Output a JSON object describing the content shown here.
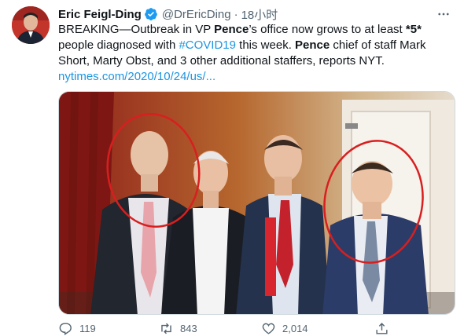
{
  "tweet": {
    "author_name": "Eric Feigl-Ding",
    "handle": "@DrEricDing",
    "separator": "·",
    "time": "18小时",
    "text": {
      "p1": "BREAKING—Outbreak in VP ",
      "b1": "Pence",
      "p2": "’s office now grows to at least ",
      "b2": "*5*",
      "p3": " people diagnosed with ",
      "hashtag": "#COVID19",
      "p4": " this week. ",
      "b3": "Pence",
      "p5": " chief of staff Mark Short, Marty Obst, and 3 other additional staffers, reports NYT.",
      "link": "nytimes.com/2020/10/24/us/..."
    }
  },
  "actions": {
    "reply_count": "119",
    "retweet_count": "843",
    "like_count": "2,014"
  },
  "icons": {
    "verified": "verified-badge-icon",
    "more": "more-icon",
    "reply": "reply-icon",
    "retweet": "retweet-icon",
    "like": "like-icon",
    "share": "share-icon"
  },
  "colors": {
    "accent": "#1b95e0",
    "text": "#0f1419",
    "muted": "#536471",
    "circle": "#d81f1f"
  }
}
